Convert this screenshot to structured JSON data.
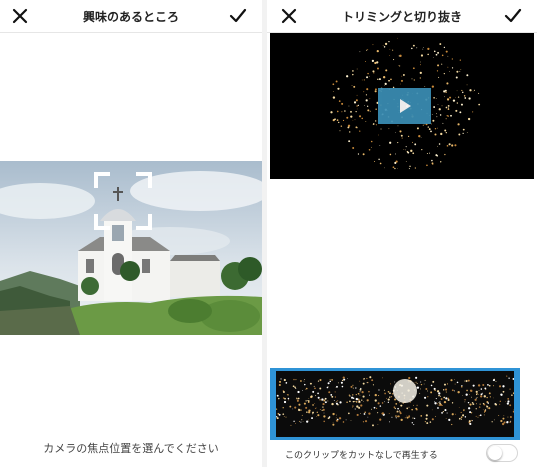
{
  "focus_screen": {
    "title": "興味のあるところ",
    "close_icon": "close-icon",
    "confirm_icon": "checkmark-icon",
    "hint": "カメラの焦点位置を選んでください"
  },
  "trim_screen": {
    "title": "トリミングと切り抜き",
    "close_icon": "close-icon",
    "confirm_icon": "checkmark-icon",
    "play_icon": "play-icon",
    "clip_label": "このクリップをカットなしで再生する",
    "toggle_on": false
  },
  "colors": {
    "accent_blue": "#2f93d6",
    "play_button": "#3b8fb6"
  }
}
